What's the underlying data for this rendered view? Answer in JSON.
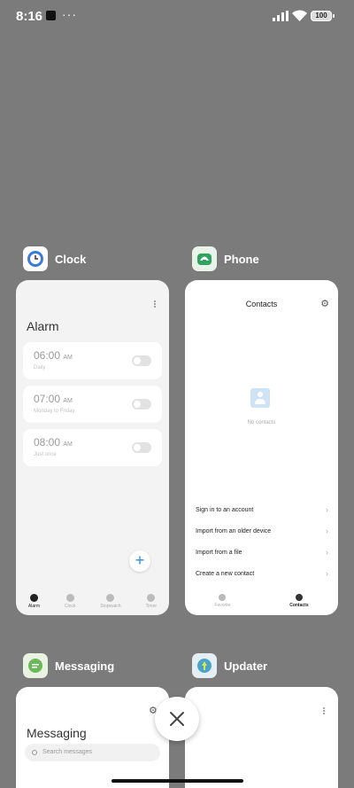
{
  "status": {
    "time": "8:16",
    "dots": "···",
    "battery": "100"
  },
  "apps": {
    "clock": {
      "name": "Clock",
      "title": "Alarm",
      "alarms": [
        {
          "time": "06:00",
          "ampm": "AM",
          "sub": "Daily"
        },
        {
          "time": "07:00",
          "ampm": "AM",
          "sub": "Monday to Friday"
        },
        {
          "time": "08:00",
          "ampm": "AM",
          "sub": "Just once"
        }
      ],
      "fab": "+",
      "tabs": [
        "Alarm",
        "Clock",
        "Stopwatch",
        "Timer"
      ]
    },
    "phone": {
      "name": "Phone",
      "title": "Contacts",
      "empty": "No contacts",
      "options": [
        "Sign in to an account",
        "Import from an older device",
        "Import from a file",
        "Create a new contact"
      ],
      "tabs": [
        "Favorite",
        "Contacts"
      ]
    },
    "messaging": {
      "name": "Messaging",
      "title": "Messaging",
      "search_placeholder": "Search messages"
    },
    "updater": {
      "name": "Updater"
    }
  },
  "colors": {
    "background": "#7b7b7b",
    "accent": "#2b8ae6"
  }
}
